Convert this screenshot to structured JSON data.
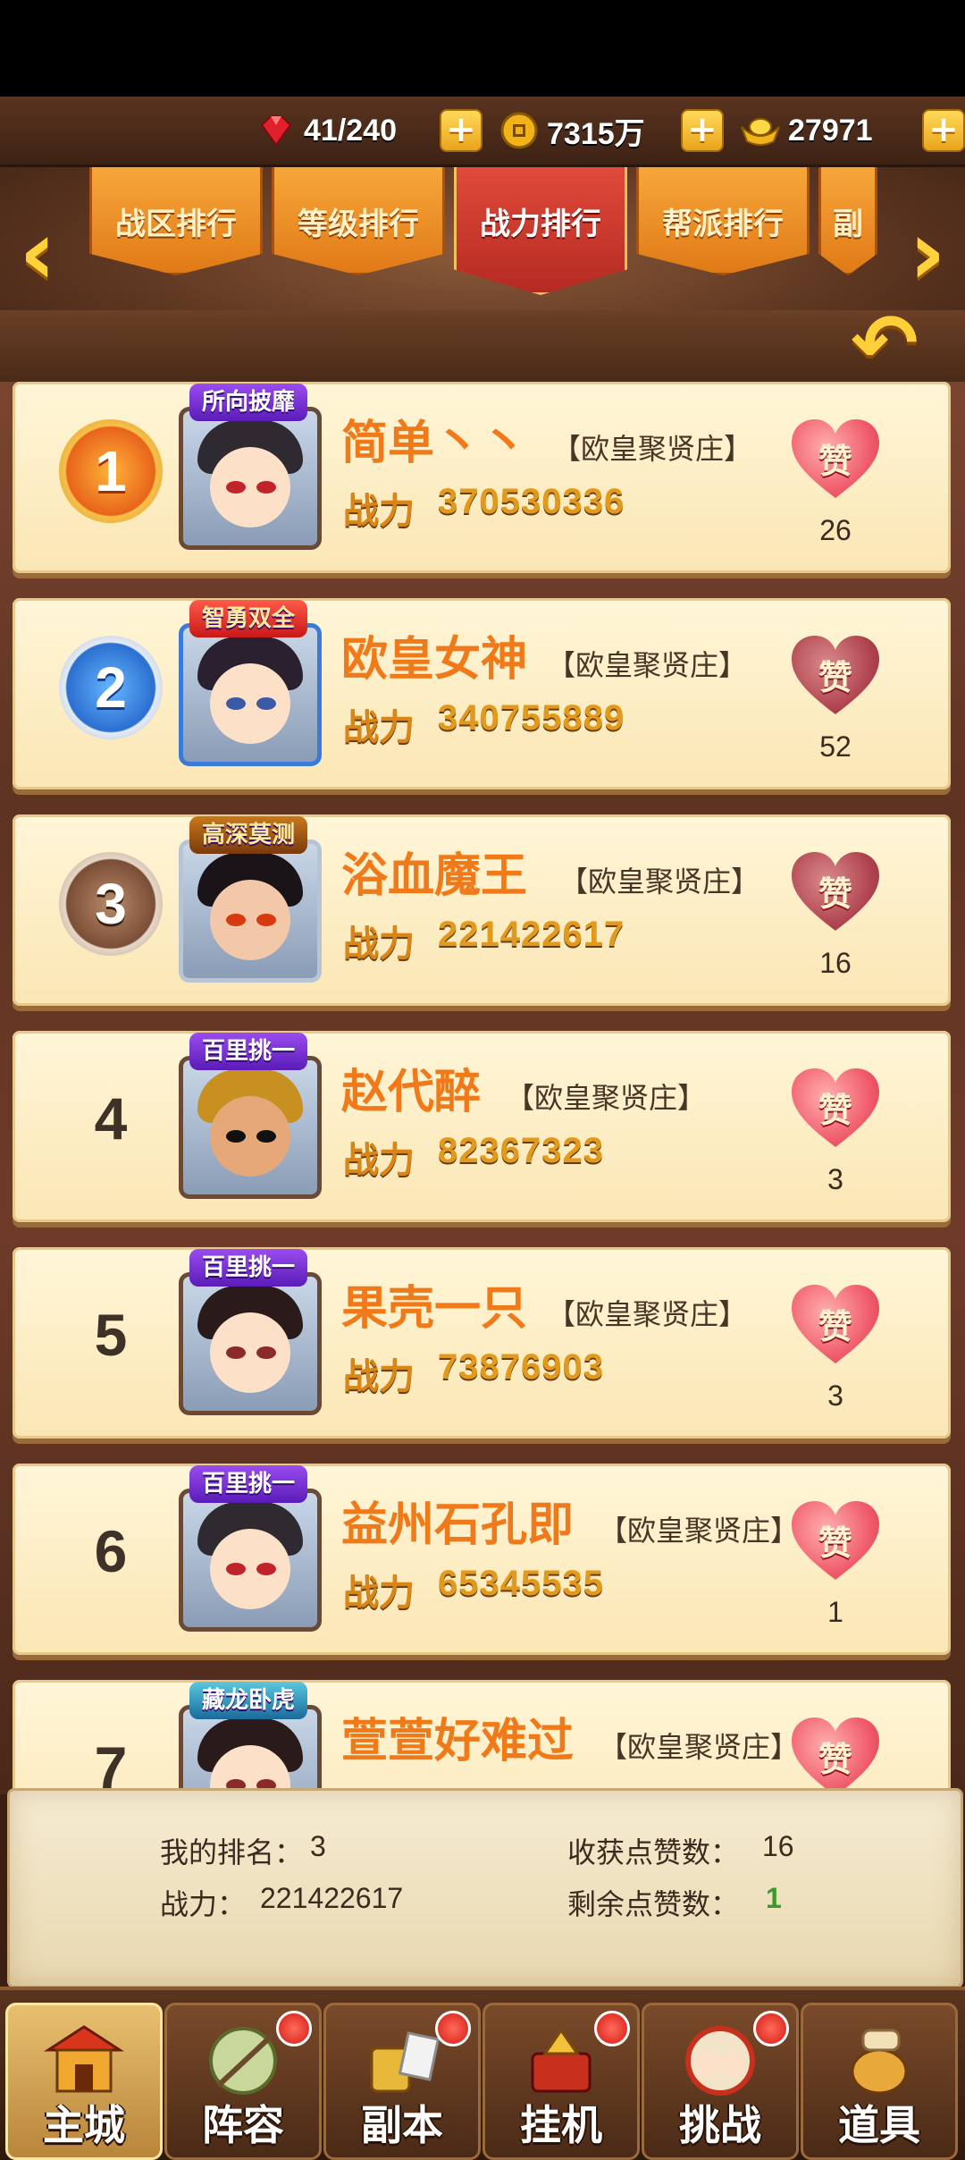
{
  "resources": [
    {
      "icon": "ruby-icon",
      "value": "41/240"
    },
    {
      "icon": "coin-icon",
      "value": "7315万"
    },
    {
      "icon": "gold-ingot-icon",
      "value": "27971"
    }
  ],
  "tabs": [
    {
      "label": "战区排行",
      "active": false
    },
    {
      "label": "等级排行",
      "active": false
    },
    {
      "label": "战力排行",
      "active": true
    },
    {
      "label": "帮派排行",
      "active": false
    },
    {
      "label": "副",
      "active": false
    }
  ],
  "power_label": "战力",
  "like_glyph": "赞",
  "rankings": [
    {
      "rank": "1",
      "title": "所向披靡",
      "name": "简单丶丶",
      "guild": "【欧皇聚贤庄】",
      "power": "370530336",
      "likes": "26"
    },
    {
      "rank": "2",
      "title": "智勇双全",
      "name": "欧皇女神",
      "guild": "【欧皇聚贤庄】",
      "power": "340755889",
      "likes": "52"
    },
    {
      "rank": "3",
      "title": "高深莫测",
      "name": "浴血魔王",
      "guild": "【欧皇聚贤庄】",
      "power": "221422617",
      "likes": "16"
    },
    {
      "rank": "4",
      "title": "百里挑一",
      "name": "赵代醉",
      "guild": "【欧皇聚贤庄】",
      "power": "82367323",
      "likes": "3"
    },
    {
      "rank": "5",
      "title": "百里挑一",
      "name": "果壳一只",
      "guild": "【欧皇聚贤庄】",
      "power": "73876903",
      "likes": "3"
    },
    {
      "rank": "6",
      "title": "百里挑一",
      "name": "益州石孔即",
      "guild": "【欧皇聚贤庄】",
      "power": "65345535",
      "likes": "1"
    },
    {
      "rank": "7",
      "title": "藏龙卧虎",
      "name": "萱萱好难过",
      "guild": "【欧皇聚贤庄】",
      "power": "",
      "likes": ""
    }
  ],
  "summary": {
    "my_rank_label": "我的排名：",
    "my_rank_value": "3",
    "power_label": "战力：",
    "power_value": "221422617",
    "received_likes_label": "收获点赞数：",
    "received_likes_value": "16",
    "remaining_likes_label": "剩余点赞数：",
    "remaining_likes_value": "1"
  },
  "nav": [
    {
      "label": "主城",
      "icon": "city-gate-icon",
      "active": true,
      "badge": false
    },
    {
      "label": "阵容",
      "icon": "formation-icon",
      "active": false,
      "badge": true
    },
    {
      "label": "副本",
      "icon": "dungeon-icon",
      "active": false,
      "badge": true
    },
    {
      "label": "挂机",
      "icon": "idle-treasure-icon",
      "active": false,
      "badge": true
    },
    {
      "label": "挑战",
      "icon": "challenge-icon",
      "active": false,
      "badge": true
    },
    {
      "label": "道具",
      "icon": "items-bag-icon",
      "active": false,
      "badge": false
    }
  ]
}
